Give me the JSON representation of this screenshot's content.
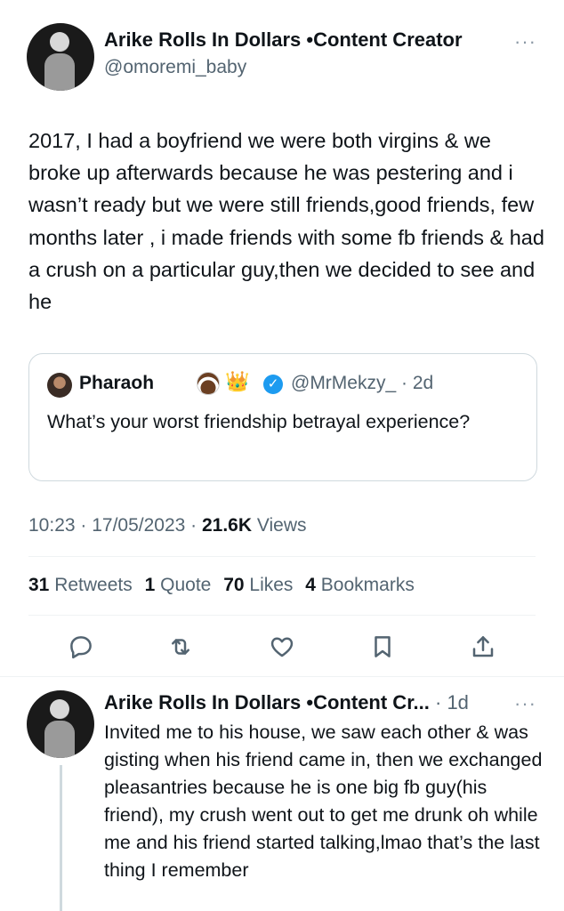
{
  "tweet": {
    "author_name": "Arike Rolls In Dollars •Content Creator",
    "author_handle": "@omoremi_baby",
    "more_glyph": "···",
    "text": "2017, I had a boyfriend we were both virgins & we broke up afterwards because he was pestering and i wasn’t ready but we were still friends,good friends, few months later , i made friends with some fb friends & had a crush on a particular guy,then we decided to see and he",
    "quote": {
      "name": "Pharaoh",
      "crown_emoji": "👑",
      "verified_glyph": "✓",
      "handle_time": "@MrMekzy_ · 2d",
      "text": "What’s your worst friendship betrayal experience?"
    },
    "meta": {
      "time_date": "10:23 · 17/05/2023 · ",
      "views_count": "21.6K",
      "views_label": " Views"
    },
    "stats": [
      {
        "count": "31",
        "label": "Retweets"
      },
      {
        "count": "1",
        "label": "Quote"
      },
      {
        "count": "70",
        "label": "Likes"
      },
      {
        "count": "4",
        "label": "Bookmarks"
      }
    ],
    "actions": [
      "reply-icon",
      "retweet-icon",
      "like-icon",
      "bookmark-icon",
      "share-icon"
    ]
  },
  "reply": {
    "author_name": "Arike Rolls In Dollars •Content Cr...",
    "time": " · 1d",
    "more_glyph": "···",
    "text": "Invited me to his house, we saw each other & was gisting when his friend came in, then we exchanged pleasantries because he is one big fb guy(his friend), my crush went out to get me drunk oh while me and his friend started talking,lmao that’s the last thing I remember"
  },
  "colors": {
    "text": "#0f1419",
    "secondary": "#536471",
    "border": "#cfd9de",
    "verified": "#1d9bf0"
  }
}
